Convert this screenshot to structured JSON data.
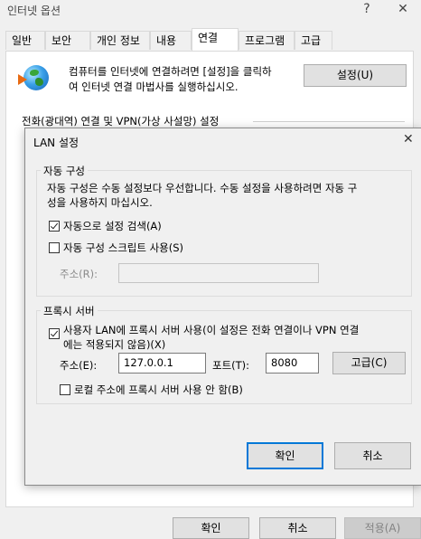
{
  "internet_options": {
    "title": "인터넷 옵션",
    "help": "?",
    "close": "✕",
    "tabs": [
      "일반",
      "보안",
      "개인 정보",
      "내용",
      "연결",
      "프로그램",
      "고급"
    ],
    "active_tab_index": 4,
    "setup_text_line1": "컴퓨터를 인터넷에 연결하려면 [설정]을 클릭하",
    "setup_text_line2": "여 인터넷 연결 마법사를 실행하십시오.",
    "setup_button": "설정(U)",
    "dialup_heading": "전화(광대역) 연결 및 VPN(가상 사설망) 설정",
    "ok": "확인",
    "cancel": "취소",
    "apply": "적용(A)"
  },
  "lan": {
    "title": "LAN 설정",
    "close": "✕",
    "auto_config": {
      "label": "자동 구성",
      "desc_line1": "자동 구성은 수동 설정보다 우선합니다. 수동 설정을 사용하려면 자동 구",
      "desc_line2": "성을 사용하지 마십시오.",
      "auto_detect_label": "자동으로 설정 검색(A)",
      "auto_detect_checked": true,
      "script_label": "자동 구성 스크립트 사용(S)",
      "script_checked": false,
      "address_label": "주소(R):",
      "address_value": ""
    },
    "proxy": {
      "label": "프록시 서버",
      "use_proxy_line1": "사용자 LAN에 프록시 서버 사용(이 설정은 전화 연결이나 VPN 연결",
      "use_proxy_line2": "에는 적용되지 않음)(X)",
      "use_proxy_checked": true,
      "address_label": "주소(E):",
      "address_value": "127.0.0.1",
      "port_label": "포트(T):",
      "port_value": "8080",
      "advanced_button": "고급(C)",
      "bypass_label": "로컬 주소에 프록시 서버 사용 안 함(B)",
      "bypass_checked": false
    },
    "ok": "확인",
    "cancel": "취소"
  }
}
